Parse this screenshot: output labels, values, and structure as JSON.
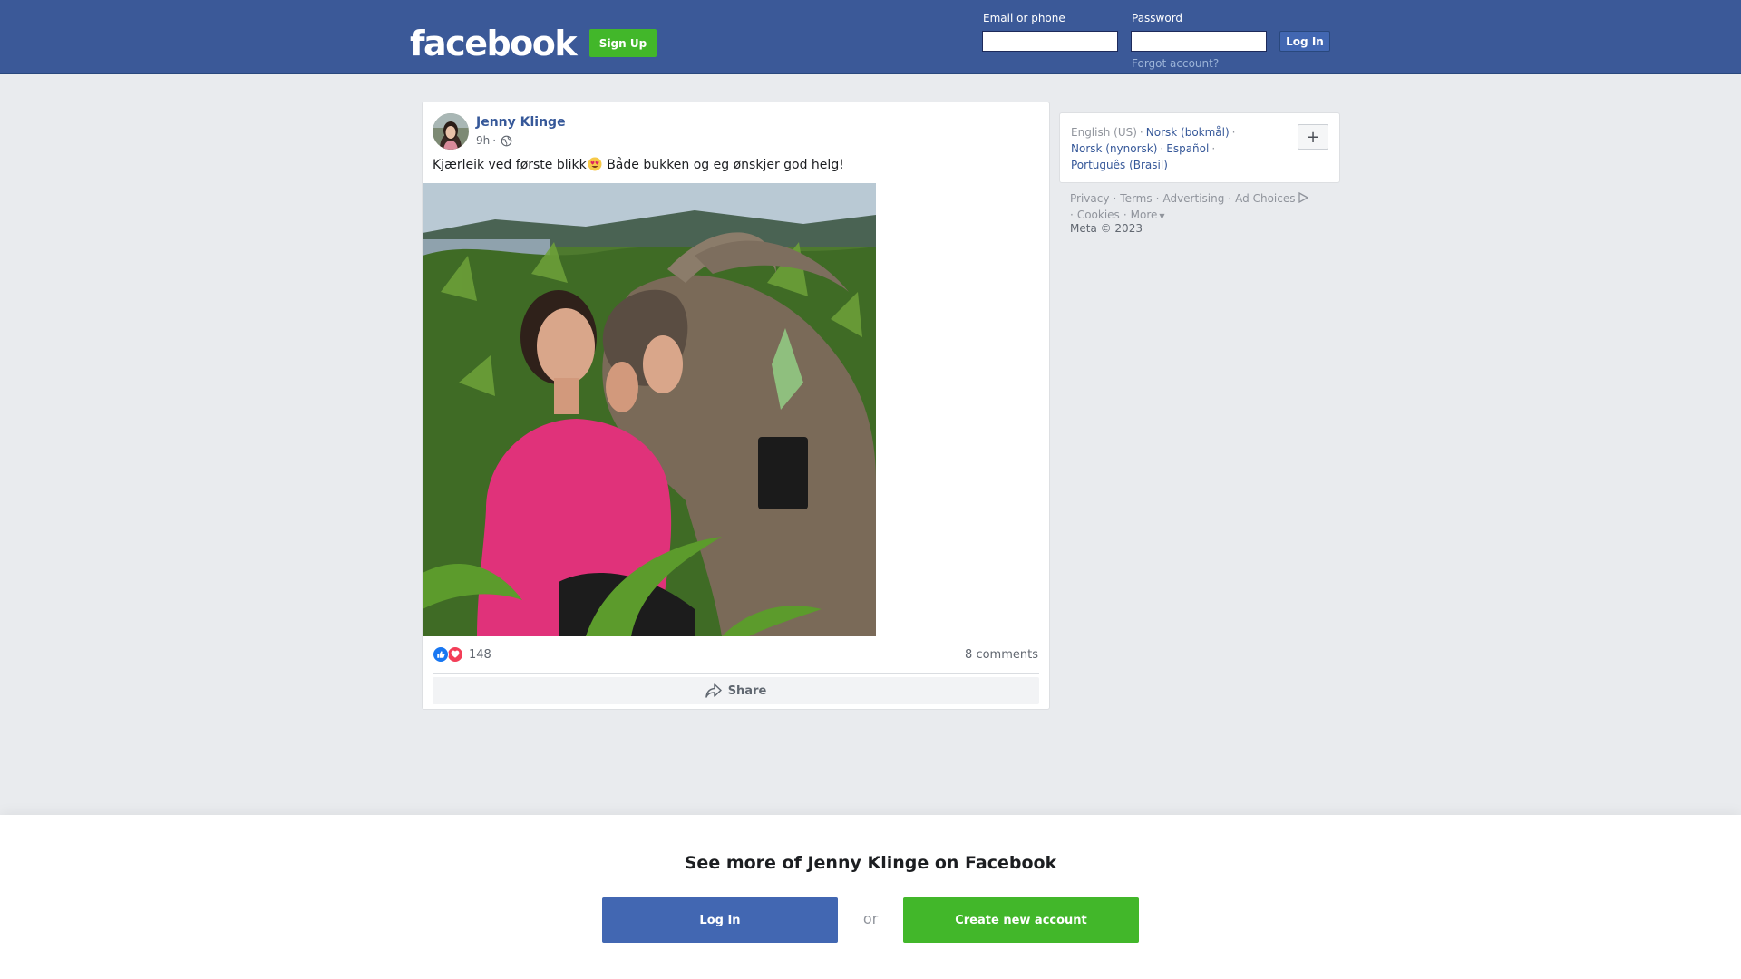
{
  "header": {
    "logo_text": "facebook",
    "signup_label": "Sign Up",
    "email_label": "Email or phone",
    "email_value": "",
    "password_label": "Password",
    "password_value": "",
    "login_label": "Log In",
    "forgot_label": "Forgot account?"
  },
  "post": {
    "author": "Jenny Klinge",
    "time": "9h",
    "privacy_icon": "globe-icon",
    "text_before_emoji": "Kjærleik ved første blikk",
    "emoji": "heart-eyes-emoji",
    "text_after_emoji": " Både bukken og eg ønskjer god helg!",
    "photo": "woman-kissing-goat-photo",
    "reaction_count": "148",
    "reaction_icons": [
      "like-icon",
      "love-icon"
    ],
    "comments_label": "8 comments",
    "share_label": "Share"
  },
  "languages": {
    "current": "English (US)",
    "items": [
      "Norsk (bokmål)",
      "Norsk (nynorsk)",
      "Español",
      "Português (Brasil)"
    ],
    "more_label": "+"
  },
  "footer": {
    "links": [
      "Privacy",
      "Terms",
      "Advertising",
      "Ad Choices",
      "Cookies",
      "More"
    ],
    "copyright": "Meta © 2023"
  },
  "banner": {
    "title": "See more of Jenny Klinge on Facebook",
    "login_label": "Log In",
    "or_label": "or",
    "create_label": "Create new account"
  },
  "colors": {
    "brand_blue": "#3b5998",
    "button_blue": "#4267b2",
    "link_blue": "#365899",
    "signup_green": "#42b72a",
    "page_bg": "#e9ebee"
  }
}
